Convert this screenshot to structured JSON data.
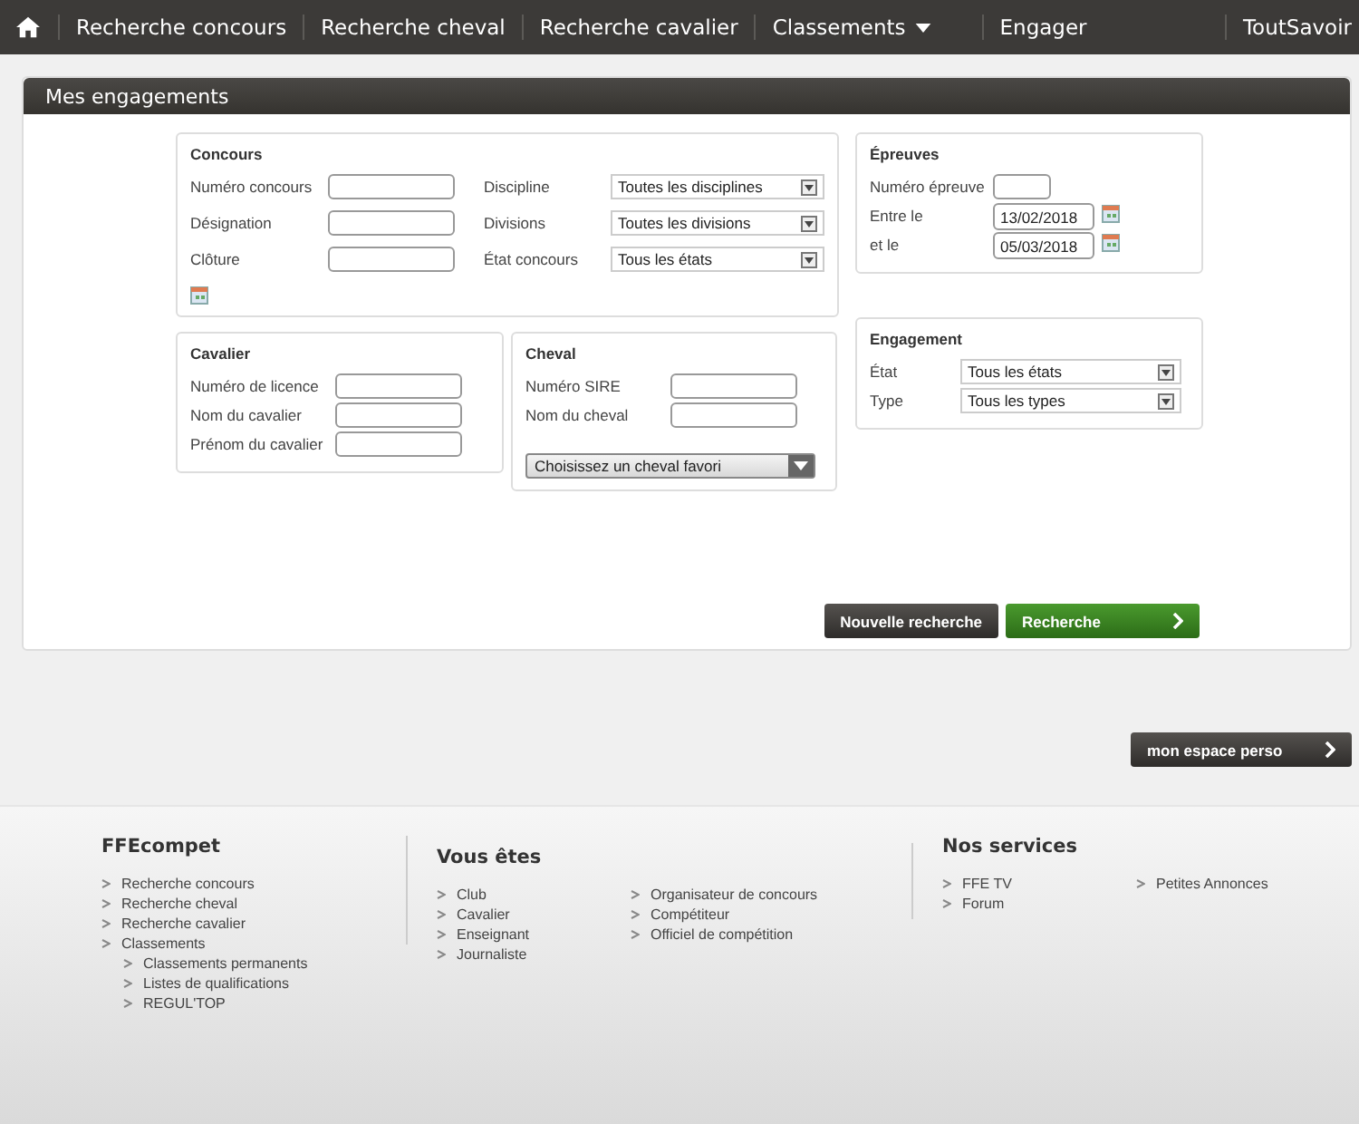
{
  "nav": {
    "items": [
      {
        "label": "Recherche concours",
        "dropdown": false
      },
      {
        "label": "Recherche cheval",
        "dropdown": false
      },
      {
        "label": "Recherche cavalier",
        "dropdown": false
      },
      {
        "label": "Classements",
        "dropdown": true
      },
      {
        "label": "Engager",
        "dropdown": false
      }
    ],
    "right": "ToutSavoir"
  },
  "panel": {
    "title": "Mes engagements"
  },
  "concours": {
    "title": "Concours",
    "left": [
      {
        "label": "Numéro concours",
        "kind": "text"
      },
      {
        "label": "Désignation",
        "kind": "text"
      },
      {
        "label": "Clôture",
        "kind": "date_below"
      }
    ],
    "right": [
      {
        "label": "Discipline",
        "kind": "select",
        "value": "Toutes les disciplines"
      },
      {
        "label": "Divisions",
        "kind": "select",
        "value": "Toutes les divisions"
      },
      {
        "label": "État concours",
        "kind": "select",
        "value": "Tous les états"
      }
    ]
  },
  "epreuves": {
    "title": "Épreuves",
    "fields": [
      {
        "label": "Numéro épreuve",
        "kind": "short"
      },
      {
        "label": "Entre le",
        "kind": "date",
        "value": "13/02/2018"
      },
      {
        "label": "et le",
        "kind": "date",
        "value": "05/03/2018"
      }
    ]
  },
  "cavalier": {
    "title": "Cavalier",
    "fields": [
      {
        "label": "Numéro de licence",
        "kind": "text"
      },
      {
        "label": "Nom du cavalier",
        "kind": "text"
      },
      {
        "label": "Prénom du cavalier",
        "kind": "text"
      }
    ]
  },
  "cheval": {
    "title": "Cheval",
    "fields": [
      {
        "label": "Numéro SIRE",
        "kind": "text"
      },
      {
        "label": "Nom du cheval",
        "kind": "text"
      }
    ],
    "favorite": "Choisissez un cheval favori"
  },
  "engagement": {
    "title": "Engagement",
    "fields": [
      {
        "label": "État",
        "kind": "select",
        "value": "Tous les états"
      },
      {
        "label": "Type",
        "kind": "select",
        "value": "Tous les types"
      }
    ]
  },
  "buttons": [
    {
      "label": "Nouvelle recherche",
      "kind": "dark"
    },
    {
      "label": "Recherche",
      "kind": "green"
    }
  ],
  "perso_button": "mon espace perso",
  "footer": [
    {
      "title": "FFEcompet",
      "lists": [
        [
          {
            "label": "Recherche concours"
          },
          {
            "label": "Recherche cheval"
          },
          {
            "label": "Recherche cavalier"
          },
          {
            "label": "Classements",
            "children": [
              {
                "label": "Classements permanents"
              },
              {
                "label": "Listes de qualifications"
              },
              {
                "label": "REGUL'TOP"
              }
            ]
          }
        ]
      ]
    },
    {
      "title": "Vous êtes",
      "lists": [
        [
          {
            "label": "Club"
          },
          {
            "label": "Cavalier"
          },
          {
            "label": "Enseignant"
          },
          {
            "label": "Journaliste"
          }
        ],
        [
          {
            "label": "Organisateur de concours"
          },
          {
            "label": "Compétiteur"
          },
          {
            "label": "Officiel de compétition"
          }
        ]
      ]
    },
    {
      "title": "Nos services",
      "lists": [
        [
          {
            "label": "FFE TV"
          },
          {
            "label": "Forum"
          }
        ],
        [
          {
            "label": "Petites Annonces"
          }
        ]
      ]
    }
  ]
}
